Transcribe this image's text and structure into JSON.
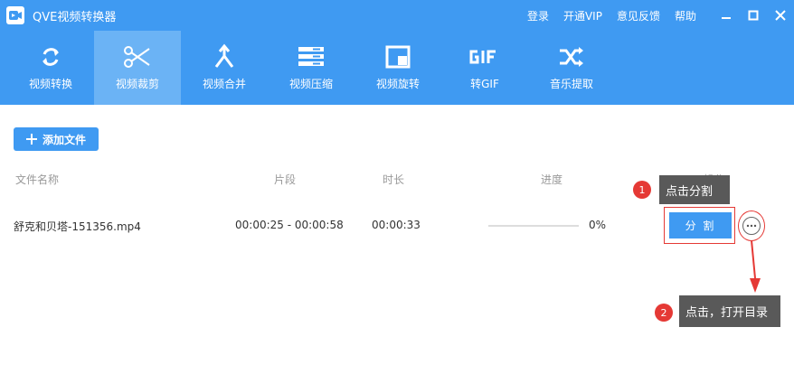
{
  "app": {
    "title": "QVE视频转换器",
    "links": [
      "登录",
      "开通VIP",
      "意见反馈",
      "帮助"
    ]
  },
  "toolbar": {
    "tools": [
      {
        "label": "视频转换",
        "icon": "refresh-icon"
      },
      {
        "label": "视频裁剪",
        "icon": "scissors-icon",
        "active": true
      },
      {
        "label": "视频合并",
        "icon": "merge-icon"
      },
      {
        "label": "视频压缩",
        "icon": "compress-icon"
      },
      {
        "label": "视频旋转",
        "icon": "rotate-icon"
      },
      {
        "label": "转GIF",
        "icon": "gif-icon"
      },
      {
        "label": "音乐提取",
        "icon": "shuffle-icon"
      }
    ]
  },
  "content": {
    "add_file": "添加文件",
    "headers": {
      "name": "文件名称",
      "segment": "片段",
      "duration": "时长",
      "progress": "进度",
      "action": "操作"
    },
    "rows": [
      {
        "name": "舒克和贝塔-151356.mp4",
        "segment": "00:00:25 - 00:00:58",
        "duration": "00:00:33",
        "progress": "0%",
        "progress_value": 0,
        "action": "分 割"
      }
    ]
  },
  "callouts": {
    "one": {
      "badge": "1",
      "text": "点击分割"
    },
    "two": {
      "badge": "2",
      "text": "点击，打开目录"
    }
  },
  "colors": {
    "primary": "#3f9af2",
    "active_tab": "#6bb3f5",
    "annotation": "#e53935",
    "callout_bg": "#595959"
  }
}
